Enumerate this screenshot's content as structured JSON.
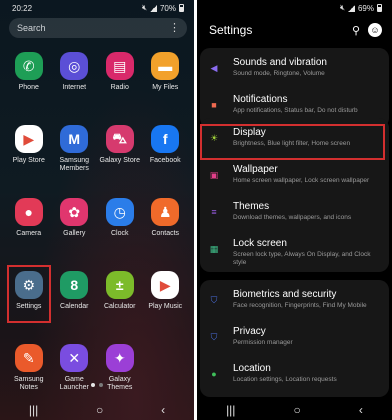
{
  "home": {
    "status": {
      "time": "20:22",
      "battery": "70%"
    },
    "search_placeholder": "Search",
    "apps": [
      {
        "label": "Phone",
        "icon": "phone-icon",
        "color": "#1e9e56",
        "glyph": "✆"
      },
      {
        "label": "Internet",
        "icon": "internet-icon",
        "color": "#5b4fd6",
        "glyph": "◎"
      },
      {
        "label": "Radio",
        "icon": "radio-icon",
        "color": "#d9296a",
        "glyph": "▤"
      },
      {
        "label": "My Files",
        "icon": "folder-icon",
        "color": "#f2a12b",
        "glyph": "▬"
      },
      {
        "label": "Play Store",
        "icon": "play-store-icon",
        "color": "#ffffff",
        "glyph": "▶"
      },
      {
        "label": "Samsung Members",
        "icon": "members-icon",
        "color": "#2f6bd8",
        "glyph": "M"
      },
      {
        "label": "Galaxy Store",
        "icon": "galaxy-store-icon",
        "color": "#d63a6e",
        "glyph": "⛍"
      },
      {
        "label": "Facebook",
        "icon": "facebook-icon",
        "color": "#1877f2",
        "glyph": "f"
      },
      {
        "label": "Camera",
        "icon": "camera-icon",
        "color": "#e23a57",
        "glyph": "●"
      },
      {
        "label": "Gallery",
        "icon": "gallery-icon",
        "color": "#e0366e",
        "glyph": "✿"
      },
      {
        "label": "Clock",
        "icon": "clock-icon",
        "color": "#2b7de9",
        "glyph": "◷"
      },
      {
        "label": "Contacts",
        "icon": "contacts-icon",
        "color": "#f06a2a",
        "glyph": "♟"
      },
      {
        "label": "Settings",
        "icon": "gear-icon",
        "color": "#4a6d8c",
        "glyph": "⚙"
      },
      {
        "label": "Calendar",
        "icon": "calendar-icon",
        "color": "#1f9b64",
        "glyph": "8"
      },
      {
        "label": "Calculator",
        "icon": "calculator-icon",
        "color": "#7cbb2a",
        "glyph": "±"
      },
      {
        "label": "Play Music",
        "icon": "play-music-icon",
        "color": "#ffffff",
        "glyph": "▶"
      },
      {
        "label": "Samsung Notes",
        "icon": "notes-icon",
        "color": "#ea5a2b",
        "glyph": "✎"
      },
      {
        "label": "Game Launcher",
        "icon": "game-launcher-icon",
        "color": "#7a4de0",
        "glyph": "✕"
      },
      {
        "label": "Galaxy Themes",
        "icon": "themes-icon",
        "color": "#9b3fd6",
        "glyph": "✦"
      }
    ]
  },
  "settings": {
    "status": {
      "battery": "69%"
    },
    "title": "Settings",
    "groups": [
      {
        "rows": [
          {
            "title": "Sounds and vibration",
            "subtitle": "Sound mode, Ringtone, Volume",
            "icon": "sound-icon",
            "color": "#8a6cf0",
            "glyph": "◀"
          },
          {
            "title": "Notifications",
            "subtitle": "App notifications, Status bar, Do not disturb",
            "icon": "notification-icon",
            "color": "#ef6a50",
            "glyph": "■"
          }
        ]
      },
      {
        "rows": [
          {
            "title": "Display",
            "subtitle": "Brightness, Blue light filter, Home screen",
            "icon": "brightness-icon",
            "color": "#a2d43a",
            "glyph": "☀"
          },
          {
            "title": "Wallpaper",
            "subtitle": "Home screen wallpaper, Lock screen wallpaper",
            "icon": "wallpaper-icon",
            "color": "#e23f8a",
            "glyph": "▣"
          },
          {
            "title": "Themes",
            "subtitle": "Download themes, wallpapers, and icons",
            "icon": "themes-icon",
            "color": "#9b5de5",
            "glyph": "≡"
          },
          {
            "title": "Lock screen",
            "subtitle": "Screen lock type, Always On Display, and Clock style",
            "icon": "lock-icon",
            "color": "#3fbf8a",
            "glyph": "▦"
          }
        ]
      },
      {
        "rows": [
          {
            "title": "Biometrics and security",
            "subtitle": "Face recognition, Fingerprints, Find My Mobile",
            "icon": "shield-icon",
            "color": "#4b6fe0",
            "glyph": "⛉"
          },
          {
            "title": "Privacy",
            "subtitle": "Permission manager",
            "icon": "privacy-icon",
            "color": "#4b6fe0",
            "glyph": "⛉"
          },
          {
            "title": "Location",
            "subtitle": "Location settings, Location requests",
            "icon": "location-icon",
            "color": "#3fbf5a",
            "glyph": "●"
          }
        ]
      }
    ]
  }
}
